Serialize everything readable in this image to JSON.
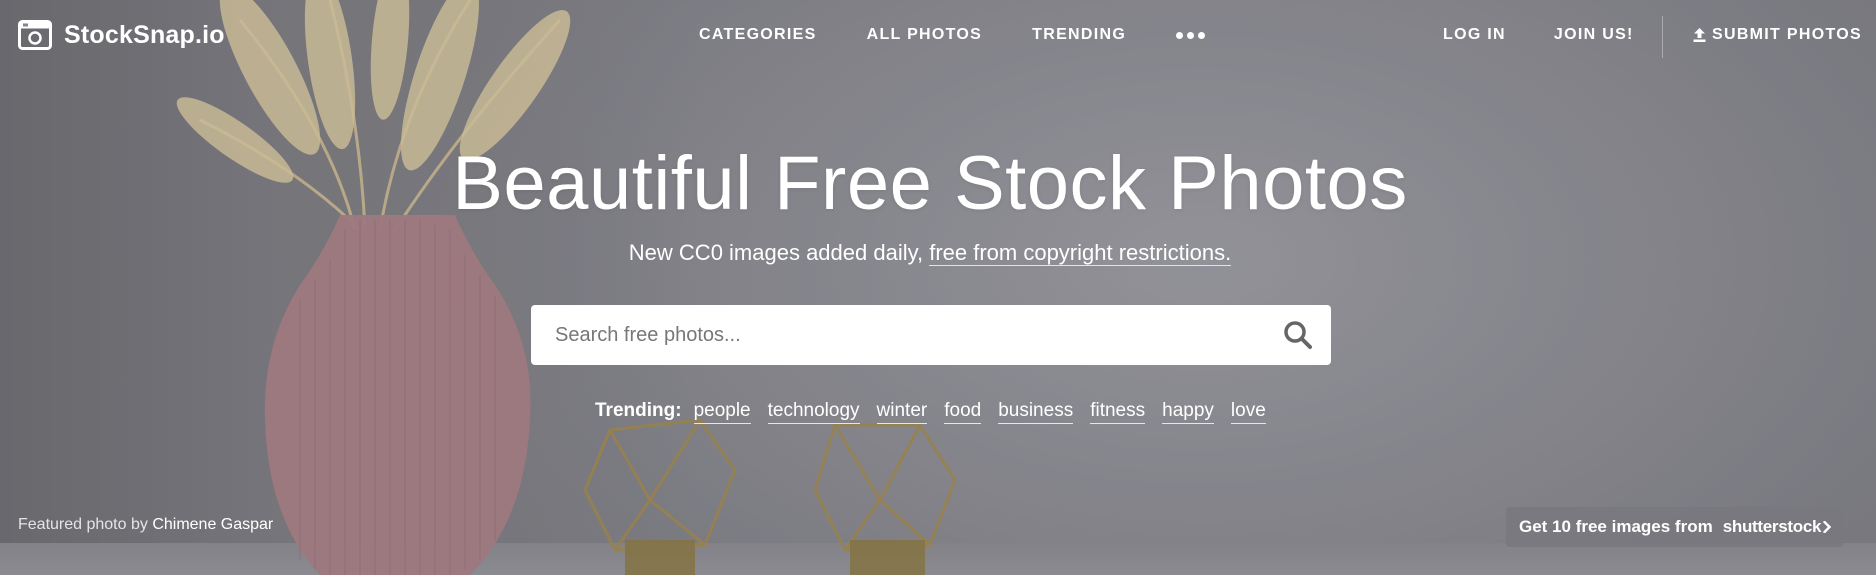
{
  "site": {
    "logo_text": "StockSnap.io"
  },
  "nav": {
    "categories": "CATEGORIES",
    "all_photos": "ALL PHOTOS",
    "trending": "TRENDING",
    "more_icon": "ellipsis-icon",
    "login": "LOG IN",
    "join": "JOIN US!",
    "submit": "SUBMIT PHOTOS",
    "submit_icon": "upload-icon"
  },
  "hero": {
    "title": "Beautiful Free Stock Photos",
    "subtitle_prefix": "New CC0 images added daily, ",
    "subtitle_link": "free from copyright restrictions."
  },
  "search": {
    "placeholder": "Search free photos...",
    "value": "",
    "icon": "search-icon"
  },
  "trending": {
    "label": "Trending:",
    "tags": [
      "people",
      "technology",
      "winter",
      "food",
      "business",
      "fitness",
      "happy",
      "love"
    ]
  },
  "credit": {
    "prefix": "Featured photo by ",
    "author": "Chimene Gaspar"
  },
  "promo": {
    "text": "Get 10 free images from",
    "brand": "shutterstock",
    "icon": "chevron-right-icon"
  },
  "colors": {
    "background": "#86868c",
    "vase": "#b8868b",
    "stems": "#d8c9a3",
    "lantern_gold": "#b59a52",
    "search_icon": "#666666"
  }
}
